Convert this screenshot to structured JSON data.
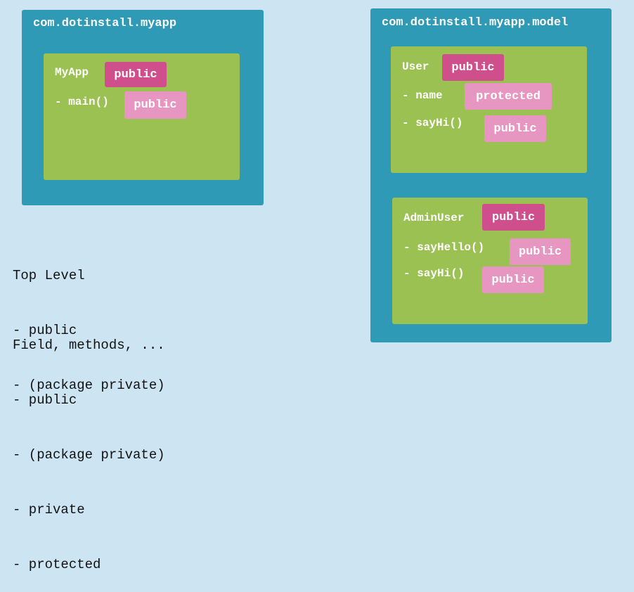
{
  "colors": {
    "background": "#cde5f3",
    "package": "#2f9ab5",
    "class": "#9bc153",
    "public_badge": "#cf4f8c",
    "member_badge": "#e796c2"
  },
  "package_myapp": {
    "title": "com.dotinstall.myapp",
    "class_myapp": {
      "name": "MyApp",
      "access": "public",
      "members": [
        {
          "name": "- main()",
          "access": "public"
        }
      ]
    }
  },
  "package_model": {
    "title": "com.dotinstall.myapp.model",
    "class_user": {
      "name": "User",
      "access": "public",
      "members": [
        {
          "name": "- name",
          "access": "protected"
        },
        {
          "name": "- sayHi()",
          "access": "public"
        }
      ]
    },
    "class_adminuser": {
      "name": "AdminUser",
      "access": "public",
      "members": [
        {
          "name": "- sayHello()",
          "access": "public"
        },
        {
          "name": "- sayHi()",
          "access": "public"
        }
      ]
    }
  },
  "notes": {
    "top_level": {
      "heading": "Top Level",
      "items": [
        "- public",
        "- (package private)"
      ]
    },
    "members": {
      "heading": "Field, methods, ...",
      "items": [
        "- public",
        "- (package private)",
        "- private",
        "- protected"
      ]
    }
  }
}
